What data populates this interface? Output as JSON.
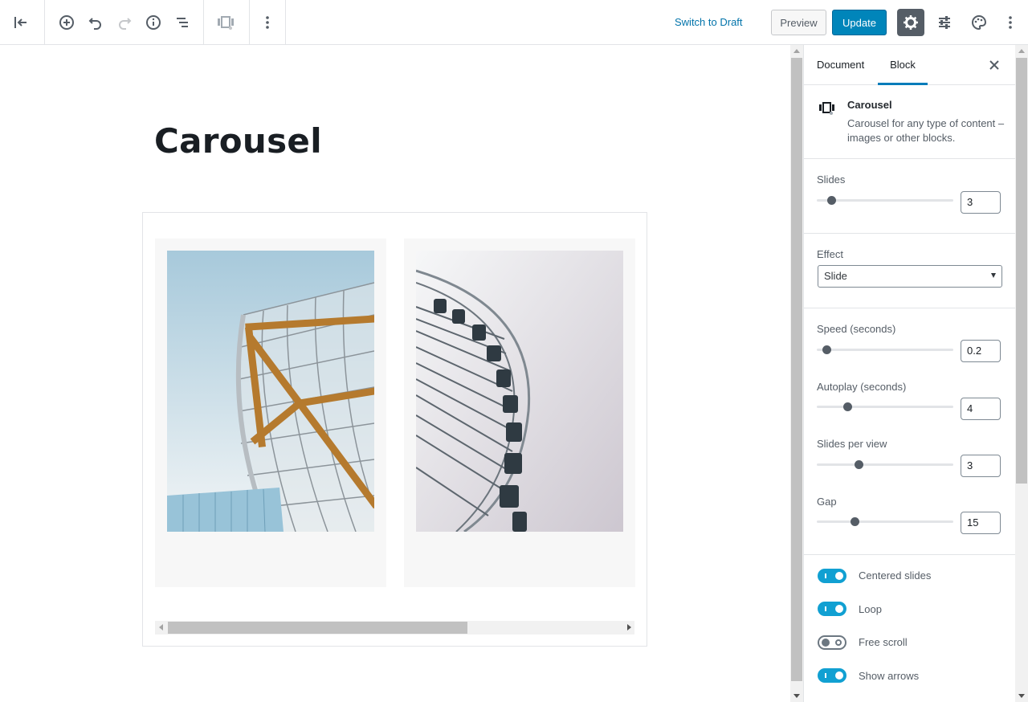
{
  "toolbar": {
    "switch_draft": "Switch to Draft",
    "preview": "Preview",
    "update": "Update",
    "icons": [
      "back-arrow-icon",
      "add-block-icon",
      "undo-icon",
      "redo-icon",
      "info-icon",
      "outline-icon",
      "carousel-block-icon",
      "more-vertical-icon",
      "gear-icon",
      "sliders-icon",
      "palette-icon",
      "more-vertical-icon"
    ]
  },
  "post": {
    "title": "Carousel"
  },
  "sidebar": {
    "tabs": {
      "document": "Document",
      "block": "Block"
    },
    "block_card": {
      "title": "Carousel",
      "description": "Carousel for any type of content – images or other blocks."
    },
    "controls": {
      "slides": {
        "label": "Slides",
        "value": "3"
      },
      "effect": {
        "label": "Effect",
        "value": "Slide"
      },
      "speed": {
        "label": "Speed (seconds)",
        "value": "0.2"
      },
      "autoplay": {
        "label": "Autoplay (seconds)",
        "value": "4"
      },
      "slides_per_view": {
        "label": "Slides per view",
        "value": "3"
      },
      "gap": {
        "label": "Gap",
        "value": "15"
      }
    },
    "toggles": {
      "centered": {
        "label": "Centered slides",
        "on": true
      },
      "loop": {
        "label": "Loop",
        "on": true
      },
      "free_scroll": {
        "label": "Free scroll",
        "on": false
      },
      "arrows": {
        "label": "Show arrows",
        "on": true
      }
    }
  },
  "colors": {
    "primary": "#0085ba",
    "link": "#0073aa",
    "toggle_on": "#11a0d2",
    "active_tab": "#007cba"
  }
}
